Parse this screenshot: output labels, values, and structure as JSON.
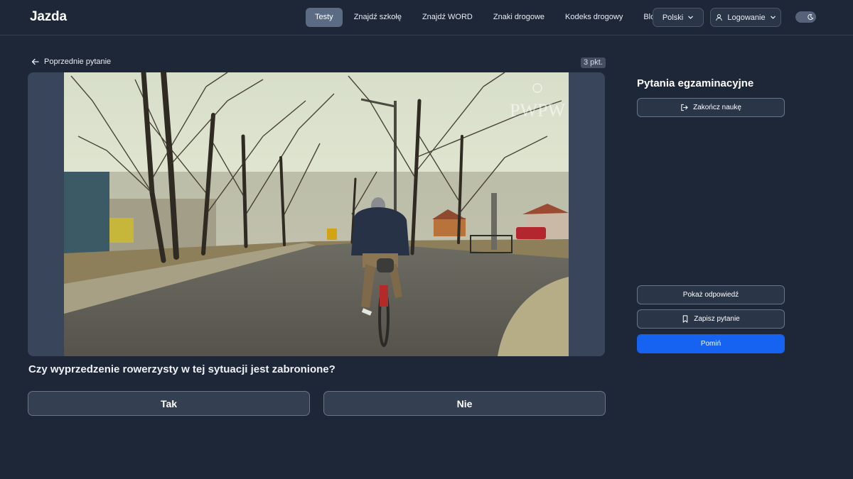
{
  "header": {
    "logo_text": "Jazda",
    "nav": [
      "Testy",
      "Znajdź szkołę",
      "Znajdź WORD",
      "Znaki drogowe",
      "Kodeks drogowy",
      "Blog"
    ],
    "active_nav": "Testy",
    "language_label": "Polski",
    "login_label": "Logowanie",
    "theme_toggle_icon": "moon-icon"
  },
  "question": {
    "back_label": "Poprzednie pytanie",
    "points_label": "3 pkt.",
    "text": "Czy wyprzedzenie rowerzysty w tej sytuacji jest zabronione?",
    "answers": [
      "Tak",
      "Nie"
    ],
    "image_watermark": "PWPW"
  },
  "sidebar": {
    "title": "Pytania egzaminacyjne",
    "end_label": "Zakończ naukę",
    "show_answer_label": "Pokaż odpowiedź",
    "save_label": "Zapisz pytanie",
    "skip_label": "Pomiń"
  },
  "colors": {
    "background": "#1e2738",
    "accent": "#1563f0",
    "active_nav_bg": "#5c6b84"
  }
}
